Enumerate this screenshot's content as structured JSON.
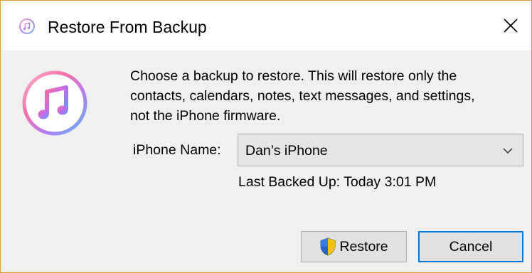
{
  "window": {
    "title": "Restore From Backup",
    "icon": "itunes-icon",
    "close_icon": "close-icon"
  },
  "main": {
    "app_icon": "itunes-icon",
    "message": "Choose a backup to restore. This will restore only the\ncontacts, calendars, notes, text messages, and settings,\nnot the iPhone firmware.",
    "iphone_name_label": "iPhone Name:",
    "iphone_name_value": "Dan’s iPhone",
    "last_backed_up": "Last Backed Up: Today 3:01 PM"
  },
  "buttons": {
    "restore": "Restore",
    "restore_icon": "uac-shield-icon",
    "cancel": "Cancel"
  },
  "colors": {
    "window_border": "#e59a3c",
    "default_button_border": "#0078d7",
    "dialog_background": "#f0f0f0"
  }
}
